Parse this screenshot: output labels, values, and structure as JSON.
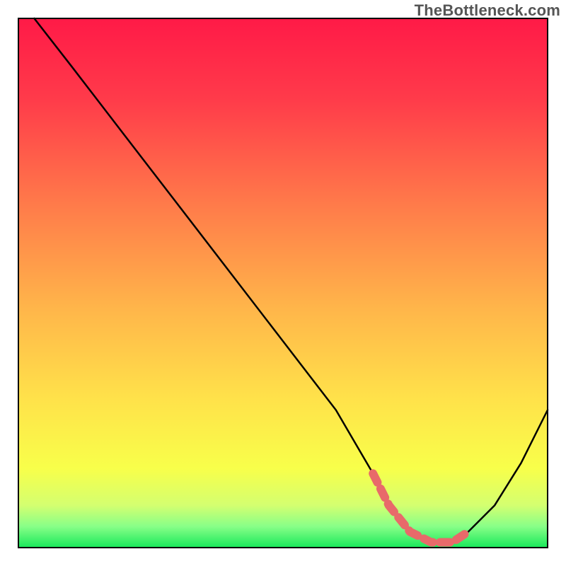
{
  "watermark": "TheBottleneck.com",
  "chart_data": {
    "type": "line",
    "title": "",
    "xlabel": "",
    "ylabel": "",
    "xlim": [
      0,
      100
    ],
    "ylim": [
      0,
      100
    ],
    "grid": false,
    "legend": false,
    "series": [
      {
        "name": "bottleneck-curve",
        "x": [
          3,
          10,
          20,
          30,
          40,
          50,
          60,
          67,
          70,
          74,
          78,
          82,
          85,
          90,
          95,
          100
        ],
        "y": [
          100,
          91,
          78,
          65,
          52,
          39,
          26,
          14,
          8,
          3,
          1,
          1,
          3,
          8,
          16,
          26
        ]
      }
    ],
    "highlight_segment": {
      "name": "optimal-range",
      "x": [
        67,
        70,
        74,
        78,
        82,
        85
      ],
      "y": [
        14,
        8,
        3,
        1,
        1,
        3
      ],
      "color": "#e86a6a"
    },
    "background_gradient": {
      "stops": [
        {
          "offset": 0.0,
          "color": "#ff1a47"
        },
        {
          "offset": 0.15,
          "color": "#ff3a4a"
        },
        {
          "offset": 0.35,
          "color": "#ff7a4a"
        },
        {
          "offset": 0.55,
          "color": "#ffb64a"
        },
        {
          "offset": 0.72,
          "color": "#ffe24a"
        },
        {
          "offset": 0.85,
          "color": "#f8ff4a"
        },
        {
          "offset": 0.92,
          "color": "#d4ff70"
        },
        {
          "offset": 0.96,
          "color": "#88ff88"
        },
        {
          "offset": 1.0,
          "color": "#18e85a"
        }
      ]
    },
    "notes": "Inner plot area ~ [26,26]-[774,774] in an 800x800 image. Axes and ticks not shown; values are relative percentages."
  }
}
